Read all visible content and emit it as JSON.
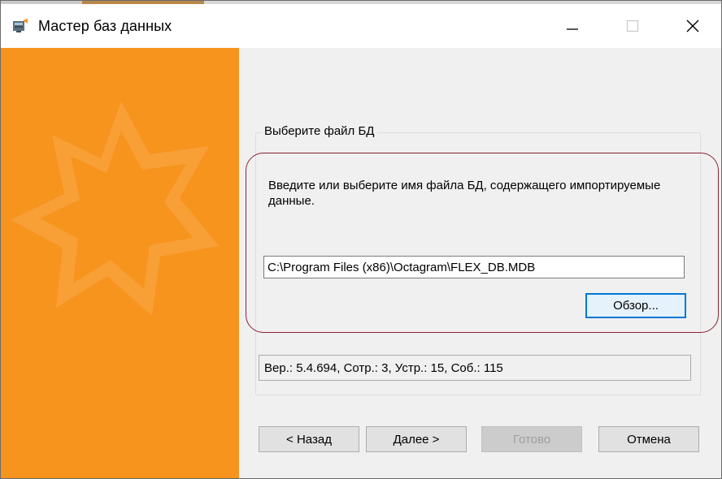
{
  "window": {
    "title": "Мастер баз данных"
  },
  "colors": {
    "side_panel": "#f6941e",
    "highlight_ring": "#8b2232",
    "focus_border": "#0078d7"
  },
  "group": {
    "legend": "Выберите файл БД",
    "description": "Введите или выберите имя файла БД, содержащего импортируемые данные.",
    "path_value": "C:\\Program Files (x86)\\Octagram\\FLEX_DB.MDB",
    "browse_label": "Обзор...",
    "status_text": "Вер.: 5.4.694, Сотр.: 3, Устр.: 15, Соб.: 115"
  },
  "footer": {
    "back_label": "< Назад",
    "next_label": "Далее >",
    "finish_label": "Готово",
    "cancel_label": "Отмена"
  },
  "icons": {
    "app": "database-wizard-icon",
    "minimize": "minimize-icon",
    "maximize": "maximize-icon",
    "close": "close-icon",
    "decoration": "star-icon"
  }
}
